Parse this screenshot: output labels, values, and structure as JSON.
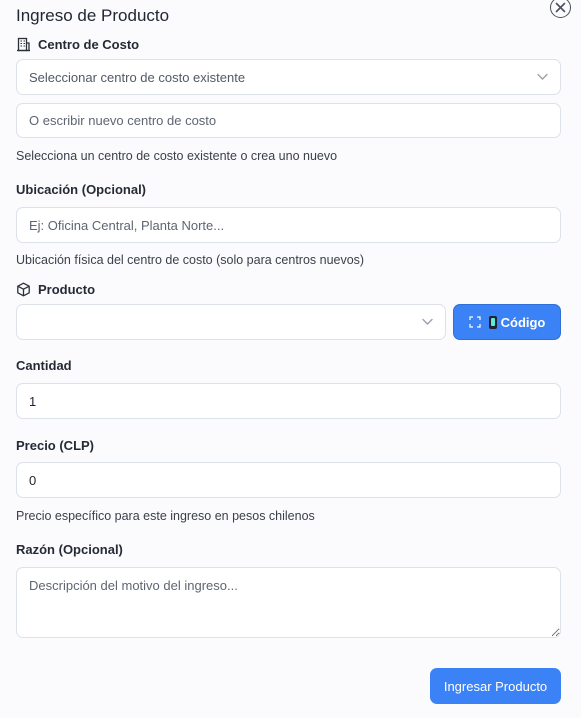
{
  "dialog": {
    "title": "Ingreso de Producto"
  },
  "cost_center": {
    "label": "Centro de Costo",
    "select_placeholder": "Seleccionar centro de costo existente",
    "new_input_placeholder": "O escribir nuevo centro de costo",
    "hint": "Selecciona un centro de costo existente o crea uno nuevo"
  },
  "location": {
    "label": "Ubicación (Opcional)",
    "placeholder": "Ej: Oficina Central, Planta Norte...",
    "hint": "Ubicación física del centro de costo (solo para centros nuevos)"
  },
  "product": {
    "label": "Producto",
    "select_value": "",
    "code_button_label": "Código"
  },
  "quantity": {
    "label": "Cantidad",
    "value": "1"
  },
  "price": {
    "label": "Precio (CLP)",
    "value": "0",
    "hint": "Precio específico para este ingreso en pesos chilenos"
  },
  "reason": {
    "label": "Razón (Opcional)",
    "placeholder": "Descripción del motivo del ingreso..."
  },
  "submit": {
    "label": "Ingresar Producto"
  },
  "colors": {
    "primary": "#3b82f6",
    "background": "#fbfbfd",
    "border": "#dde1e8"
  },
  "icons": {
    "close": "close-circle-icon",
    "cost_center": "building-icon",
    "product": "package-icon",
    "scan": "scan-icon",
    "phone": "mobile-phone-icon"
  }
}
